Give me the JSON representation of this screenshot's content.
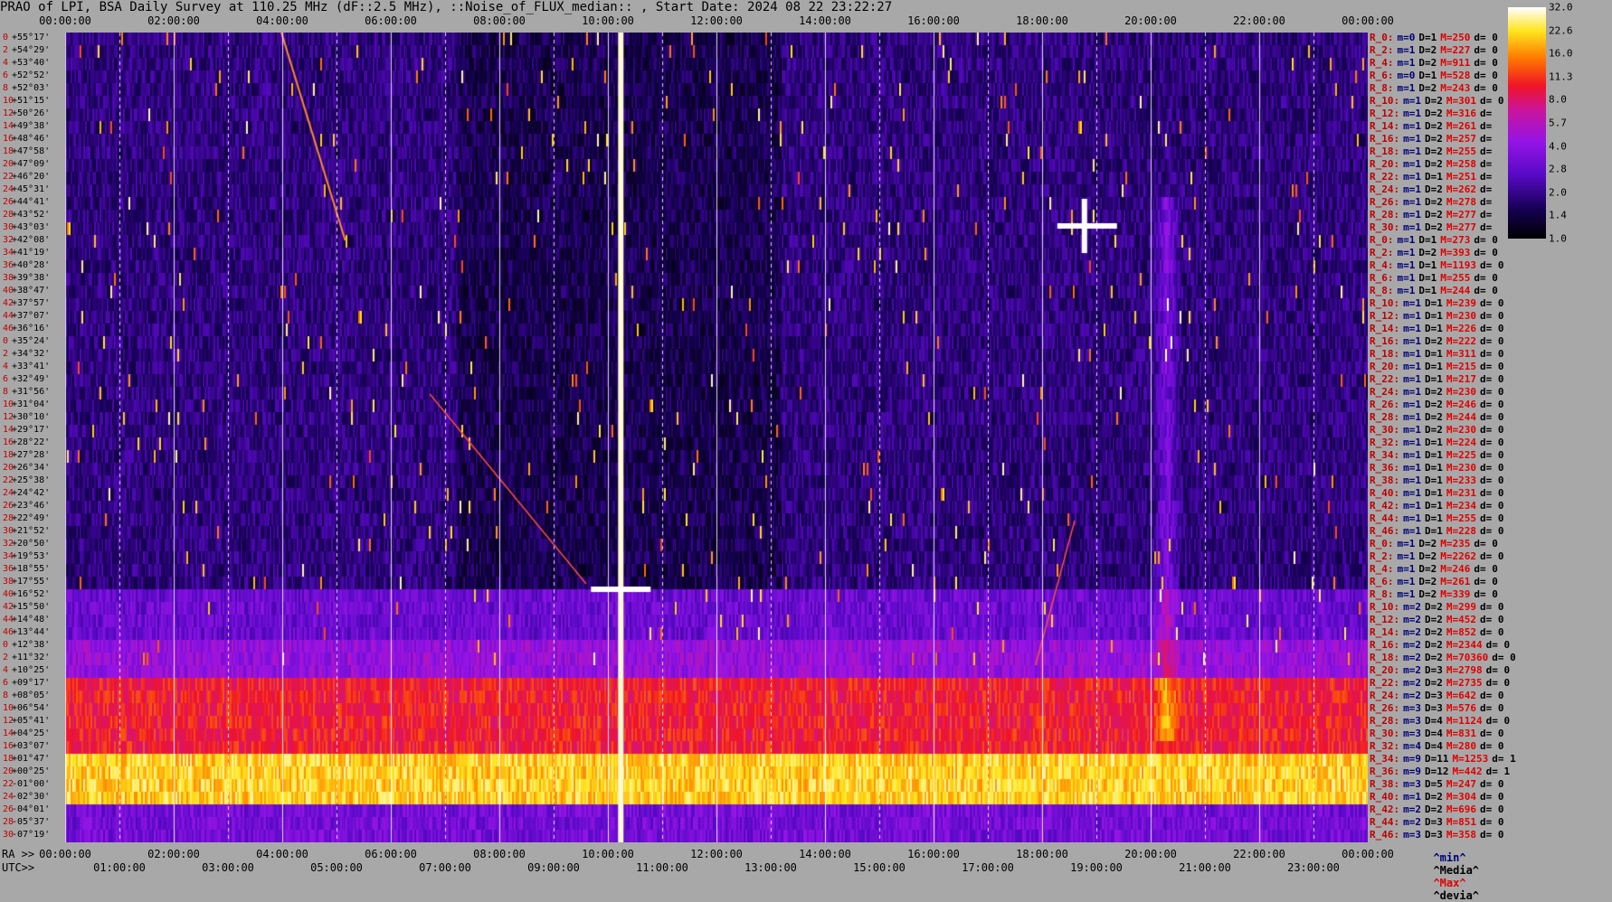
{
  "title": "PRAO of LPI, BSA Daily Survey at 110.25 MHz (dF::2.5 MHz), ::Noise_of_FLUX_median:: , Start Date: 2024 08 22 23:22:27",
  "top_ticks": [
    "00:00:00",
    "02:00:00",
    "04:00:00",
    "06:00:00",
    "08:00:00",
    "10:00:00",
    "12:00:00",
    "14:00:00",
    "16:00:00",
    "18:00:00",
    "20:00:00",
    "22:00:00",
    "00:00:00"
  ],
  "ra_axis_label": "RA >>",
  "utc_axis_label": "UTC>>",
  "ra_ticks": [
    "00:00:00",
    "02:00:00",
    "04:00:00",
    "06:00:00",
    "08:00:00",
    "10:00:00",
    "12:00:00",
    "14:00:00",
    "16:00:00",
    "18:00:00",
    "20:00:00",
    "22:00:00",
    "00:00:00"
  ],
  "utc_ticks": [
    "01:00:00",
    "03:00:00",
    "05:00:00",
    "07:00:00",
    "09:00:00",
    "11:00:00",
    "13:00:00",
    "15:00:00",
    "17:00:00",
    "19:00:00",
    "21:00:00",
    "23:00:00"
  ],
  "declinations": [
    {
      "idx": "0",
      "dec": "+55°17'"
    },
    {
      "idx": "2",
      "dec": "+54°29'"
    },
    {
      "idx": "4",
      "dec": "+53°40'"
    },
    {
      "idx": "6",
      "dec": "+52°52'"
    },
    {
      "idx": "8",
      "dec": "+52°03'"
    },
    {
      "idx": "10",
      "dec": "+51°15'"
    },
    {
      "idx": "12",
      "dec": "+50°26'"
    },
    {
      "idx": "14",
      "dec": "+49°38'"
    },
    {
      "idx": "16",
      "dec": "+48°46'"
    },
    {
      "idx": "18",
      "dec": "+47°58'"
    },
    {
      "idx": "20",
      "dec": "+47°09'"
    },
    {
      "idx": "22",
      "dec": "+46°20'"
    },
    {
      "idx": "24",
      "dec": "+45°31'"
    },
    {
      "idx": "26",
      "dec": "+44°41'"
    },
    {
      "idx": "28",
      "dec": "+43°52'"
    },
    {
      "idx": "30",
      "dec": "+43°03'"
    },
    {
      "idx": "32",
      "dec": "+42°08'"
    },
    {
      "idx": "34",
      "dec": "+41°19'"
    },
    {
      "idx": "36",
      "dec": "+40°28'"
    },
    {
      "idx": "38",
      "dec": "+39°38'"
    },
    {
      "idx": "40",
      "dec": "+38°47'"
    },
    {
      "idx": "42",
      "dec": "+37°57'"
    },
    {
      "idx": "44",
      "dec": "+37°07'"
    },
    {
      "idx": "46",
      "dec": "+36°16'"
    },
    {
      "idx": "0",
      "dec": "+35°24'"
    },
    {
      "idx": "2",
      "dec": "+34°32'"
    },
    {
      "idx": "4",
      "dec": "+33°41'"
    },
    {
      "idx": "6",
      "dec": "+32°49'"
    },
    {
      "idx": "8",
      "dec": "+31°56'"
    },
    {
      "idx": "10",
      "dec": "+31°04'"
    },
    {
      "idx": "12",
      "dec": "+30°10'"
    },
    {
      "idx": "14",
      "dec": "+29°17'"
    },
    {
      "idx": "16",
      "dec": "+28°22'"
    },
    {
      "idx": "18",
      "dec": "+27°28'"
    },
    {
      "idx": "20",
      "dec": "+26°34'"
    },
    {
      "idx": "22",
      "dec": "+25°38'"
    },
    {
      "idx": "24",
      "dec": "+24°42'"
    },
    {
      "idx": "26",
      "dec": "+23°46'"
    },
    {
      "idx": "28",
      "dec": "+22°49'"
    },
    {
      "idx": "30",
      "dec": "+21°52'"
    },
    {
      "idx": "32",
      "dec": "+20°50'"
    },
    {
      "idx": "34",
      "dec": "+19°53'"
    },
    {
      "idx": "36",
      "dec": "+18°55'"
    },
    {
      "idx": "38",
      "dec": "+17°55'"
    },
    {
      "idx": "40",
      "dec": "+16°52'"
    },
    {
      "idx": "42",
      "dec": "+15°50'"
    },
    {
      "idx": "44",
      "dec": "+14°48'"
    },
    {
      "idx": "46",
      "dec": "+13°44'"
    },
    {
      "idx": "0",
      "dec": "+12°38'"
    },
    {
      "idx": "2",
      "dec": "+11°32'"
    },
    {
      "idx": "4",
      "dec": "+10°25'"
    },
    {
      "idx": "6",
      "dec": "+09°17'"
    },
    {
      "idx": "8",
      "dec": "+08°05'"
    },
    {
      "idx": "10",
      "dec": "+06°54'"
    },
    {
      "idx": "12",
      "dec": "+05°41'"
    },
    {
      "idx": "14",
      "dec": "+04°25'"
    },
    {
      "idx": "16",
      "dec": "+03°07'"
    },
    {
      "idx": "18",
      "dec": "+01°47'"
    },
    {
      "idx": "20",
      "dec": "+00°25'"
    },
    {
      "idx": "22",
      "dec": "-01°00'"
    },
    {
      "idx": "24",
      "dec": "-02°30'"
    },
    {
      "idx": "26",
      "dec": "-04°01'"
    },
    {
      "idx": "28",
      "dec": "-05°37'"
    },
    {
      "idx": "30",
      "dec": "-07°19'"
    }
  ],
  "right_rows": [
    {
      "r": "R_0:",
      "m": "m=0",
      "D": "D=1",
      "M": "M=250",
      "d": "d= 0"
    },
    {
      "r": "R_2:",
      "m": "m=1",
      "D": "D=2",
      "M": "M=227",
      "d": "d= 0"
    },
    {
      "r": "R_4:",
      "m": "m=1",
      "D": "D=2",
      "M": "M=911",
      "d": "d= 0"
    },
    {
      "r": "R_6:",
      "m": "m=0",
      "D": "D=1",
      "M": "M=528",
      "d": "d= 0"
    },
    {
      "r": "R_8:",
      "m": "m=1",
      "D": "D=2",
      "M": "M=243",
      "d": "d= 0"
    },
    {
      "r": "R_10:",
      "m": "m=1",
      "D": "D=2",
      "M": "M=301",
      "d": "d= 0"
    },
    {
      "r": "R_12:",
      "m": "m=1",
      "D": "D=2",
      "M": "M=316",
      "d": "d="
    },
    {
      "r": "R_14:",
      "m": "m=1",
      "D": "D=2",
      "M": "M=261",
      "d": "d="
    },
    {
      "r": "R_16:",
      "m": "m=1",
      "D": "D=2",
      "M": "M=257",
      "d": "d="
    },
    {
      "r": "R_18:",
      "m": "m=1",
      "D": "D=2",
      "M": "M=255",
      "d": "d="
    },
    {
      "r": "R_20:",
      "m": "m=1",
      "D": "D=2",
      "M": "M=258",
      "d": "d="
    },
    {
      "r": "R_22:",
      "m": "m=1",
      "D": "D=1",
      "M": "M=251",
      "d": "d="
    },
    {
      "r": "R_24:",
      "m": "m=1",
      "D": "D=2",
      "M": "M=262",
      "d": "d="
    },
    {
      "r": "R_26:",
      "m": "m=1",
      "D": "D=2",
      "M": "M=278",
      "d": "d="
    },
    {
      "r": "R_28:",
      "m": "m=1",
      "D": "D=2",
      "M": "M=277",
      "d": "d="
    },
    {
      "r": "R_30:",
      "m": "m=1",
      "D": "D=2",
      "M": "M=277",
      "d": "d="
    },
    {
      "r": "R_0:",
      "m": "m=1",
      "D": "D=1",
      "M": "M=273",
      "d": "d= 0"
    },
    {
      "r": "R_2:",
      "m": "m=1",
      "D": "D=2",
      "M": "M=393",
      "d": "d= 0"
    },
    {
      "r": "R_4:",
      "m": "m=1",
      "D": "D=1",
      "M": "M=1193",
      "d": "d= 0"
    },
    {
      "r": "R_6:",
      "m": "m=1",
      "D": "D=1",
      "M": "M=255",
      "d": "d= 0"
    },
    {
      "r": "R_8:",
      "m": "m=1",
      "D": "D=1",
      "M": "M=244",
      "d": "d= 0"
    },
    {
      "r": "R_10:",
      "m": "m=1",
      "D": "D=1",
      "M": "M=239",
      "d": "d= 0"
    },
    {
      "r": "R_12:",
      "m": "m=1",
      "D": "D=1",
      "M": "M=230",
      "d": "d= 0"
    },
    {
      "r": "R_14:",
      "m": "m=1",
      "D": "D=1",
      "M": "M=226",
      "d": "d= 0"
    },
    {
      "r": "R_16:",
      "m": "m=1",
      "D": "D=2",
      "M": "M=222",
      "d": "d= 0"
    },
    {
      "r": "R_18:",
      "m": "m=1",
      "D": "D=1",
      "M": "M=311",
      "d": "d= 0"
    },
    {
      "r": "R_20:",
      "m": "m=1",
      "D": "D=1",
      "M": "M=215",
      "d": "d= 0"
    },
    {
      "r": "R_22:",
      "m": "m=1",
      "D": "D=1",
      "M": "M=217",
      "d": "d= 0"
    },
    {
      "r": "R_24:",
      "m": "m=1",
      "D": "D=2",
      "M": "M=230",
      "d": "d= 0"
    },
    {
      "r": "R_26:",
      "m": "m=1",
      "D": "D=2",
      "M": "M=246",
      "d": "d= 0"
    },
    {
      "r": "R_28:",
      "m": "m=1",
      "D": "D=2",
      "M": "M=244",
      "d": "d= 0"
    },
    {
      "r": "R_30:",
      "m": "m=1",
      "D": "D=2",
      "M": "M=230",
      "d": "d= 0"
    },
    {
      "r": "R_32:",
      "m": "m=1",
      "D": "D=1",
      "M": "M=224",
      "d": "d= 0"
    },
    {
      "r": "R_34:",
      "m": "m=1",
      "D": "D=1",
      "M": "M=225",
      "d": "d= 0"
    },
    {
      "r": "R_36:",
      "m": "m=1",
      "D": "D=1",
      "M": "M=230",
      "d": "d= 0"
    },
    {
      "r": "R_38:",
      "m": "m=1",
      "D": "D=1",
      "M": "M=233",
      "d": "d= 0"
    },
    {
      "r": "R_40:",
      "m": "m=1",
      "D": "D=1",
      "M": "M=231",
      "d": "d= 0"
    },
    {
      "r": "R_42:",
      "m": "m=1",
      "D": "D=1",
      "M": "M=234",
      "d": "d= 0"
    },
    {
      "r": "R_44:",
      "m": "m=1",
      "D": "D=1",
      "M": "M=255",
      "d": "d= 0"
    },
    {
      "r": "R_46:",
      "m": "m=1",
      "D": "D=1",
      "M": "M=228",
      "d": "d= 0"
    },
    {
      "r": "R_0:",
      "m": "m=1",
      "D": "D=2",
      "M": "M=235",
      "d": "d= 0"
    },
    {
      "r": "R_2:",
      "m": "m=1",
      "D": "D=2",
      "M": "M=2262",
      "d": "d= 0"
    },
    {
      "r": "R_4:",
      "m": "m=1",
      "D": "D=2",
      "M": "M=246",
      "d": "d= 0"
    },
    {
      "r": "R_6:",
      "m": "m=1",
      "D": "D=2",
      "M": "M=261",
      "d": "d= 0"
    },
    {
      "r": "R_8:",
      "m": "m=1",
      "D": "D=2",
      "M": "M=339",
      "d": "d= 0"
    },
    {
      "r": "R_10:",
      "m": "m=2",
      "D": "D=2",
      "M": "M=299",
      "d": "d= 0"
    },
    {
      "r": "R_12:",
      "m": "m=2",
      "D": "D=2",
      "M": "M=452",
      "d": "d= 0"
    },
    {
      "r": "R_14:",
      "m": "m=2",
      "D": "D=2",
      "M": "M=852",
      "d": "d= 0"
    },
    {
      "r": "R_16:",
      "m": "m=2",
      "D": "D=2",
      "M": "M=2344",
      "d": "d= 0"
    },
    {
      "r": "R_18:",
      "m": "m=2",
      "D": "D=2",
      "M": "M=70360",
      "d": "d= 0"
    },
    {
      "r": "R_20:",
      "m": "m=2",
      "D": "D=3",
      "M": "M=2798",
      "d": "d= 0"
    },
    {
      "r": "R_22:",
      "m": "m=2",
      "D": "D=2",
      "M": "M=2735",
      "d": "d= 0"
    },
    {
      "r": "R_24:",
      "m": "m=2",
      "D": "D=3",
      "M": "M=642",
      "d": "d= 0"
    },
    {
      "r": "R_26:",
      "m": "m=3",
      "D": "D=3",
      "M": "M=576",
      "d": "d= 0"
    },
    {
      "r": "R_28:",
      "m": "m=3",
      "D": "D=4",
      "M": "M=1124",
      "d": "d= 0"
    },
    {
      "r": "R_30:",
      "m": "m=3",
      "D": "D=4",
      "M": "M=831",
      "d": "d= 0"
    },
    {
      "r": "R_32:",
      "m": "m=4",
      "D": "D=4",
      "M": "M=280",
      "d": "d= 0"
    },
    {
      "r": "R_34:",
      "m": "m=9",
      "D": "D=11",
      "M": "M=1253",
      "d": "d= 1"
    },
    {
      "r": "R_36:",
      "m": "m=9",
      "D": "D=12",
      "M": "M=442",
      "d": "d= 1"
    },
    {
      "r": "R_38:",
      "m": "m=3",
      "D": "D=5",
      "M": "M=247",
      "d": "d= 0"
    },
    {
      "r": "R_40:",
      "m": "m=1",
      "D": "D=2",
      "M": "M=304",
      "d": "d= 0"
    },
    {
      "r": "R_42:",
      "m": "m=2",
      "D": "D=2",
      "M": "M=696",
      "d": "d= 0"
    },
    {
      "r": "R_44:",
      "m": "m=2",
      "D": "D=3",
      "M": "M=851",
      "d": "d= 0"
    },
    {
      "r": "R_46:",
      "m": "m=3",
      "D": "D=3",
      "M": "M=358",
      "d": "d= 0"
    }
  ],
  "colorbar_labels": [
    "32.0",
    "22.6",
    "16.0",
    "11.3",
    "8.0",
    "5.7",
    "4.0",
    "2.8",
    "2.0",
    "1.4",
    "1.0"
  ],
  "legend": {
    "min": "^min^",
    "median": "^Media^",
    "max": "^Max^",
    "devia": "^devia^"
  },
  "colors": {
    "min": "#00007a",
    "median": "#000000",
    "max": "#e00000",
    "devia": "#000000"
  },
  "chart_data": {
    "type": "heatmap",
    "title": "PRAO of LPI, BSA Daily Survey at 110.25 MHz (dF::2.5 MHz), ::Noise_of_FLUX_median:: , Start Date: 2024 08 22 23:22:27",
    "xlabel": "RA / UTC",
    "x_range": [
      "00:00:00",
      "24:00:00"
    ],
    "y_range": [
      "+55°17'",
      "-07°19'"
    ],
    "rows": 64,
    "color_scale": "log",
    "color_range": [
      1.0,
      32.0
    ],
    "colormap": "black-purple-red-yellow-white",
    "grid": true,
    "notes_visible": []
  }
}
